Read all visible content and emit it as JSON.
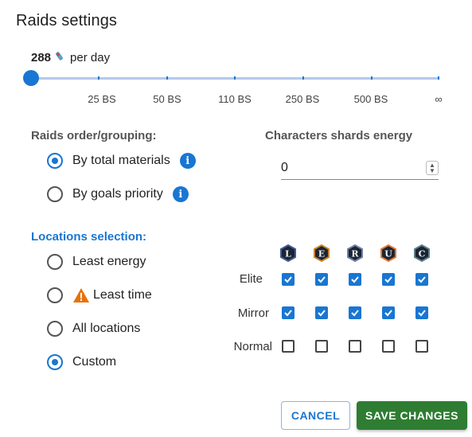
{
  "title": "Raids settings",
  "energy": {
    "value": "288",
    "suffix": "per day",
    "icon": "energy-icon"
  },
  "slider": {
    "value_fraction": 0,
    "ticks": [
      "25 BS",
      "50 BS",
      "110 BS",
      "250 BS",
      "500 BS",
      "∞"
    ]
  },
  "grouping": {
    "label": "Raids order/grouping:",
    "options": [
      {
        "label": "By total materials",
        "selected": true
      },
      {
        "label": "By goals priority",
        "selected": false
      }
    ]
  },
  "shards": {
    "label": "Characters shards energy",
    "value": "0"
  },
  "locations": {
    "label": "Locations selection:",
    "options": [
      {
        "label": "Least energy",
        "selected": false
      },
      {
        "label": "Least time",
        "selected": false,
        "icon": "warning-icon"
      },
      {
        "label": "All locations",
        "selected": false
      },
      {
        "label": "Custom",
        "selected": true
      }
    ]
  },
  "ranks": [
    "L",
    "E",
    "R",
    "U",
    "C"
  ],
  "rank_colors": [
    "#3d5a99",
    "#c9852a",
    "#6b7fa8",
    "#e07a30",
    "#5d7f8c"
  ],
  "grid": {
    "rows": [
      {
        "label": "Elite",
        "checks": [
          true,
          true,
          true,
          true,
          true
        ]
      },
      {
        "label": "Mirror",
        "checks": [
          true,
          true,
          true,
          true,
          true
        ]
      },
      {
        "label": "Normal",
        "checks": [
          false,
          false,
          false,
          false,
          false
        ]
      }
    ]
  },
  "buttons": {
    "cancel": "CANCEL",
    "save": "SAVE CHANGES"
  },
  "colors": {
    "accent": "#1976d2",
    "save": "#2e7d32"
  }
}
